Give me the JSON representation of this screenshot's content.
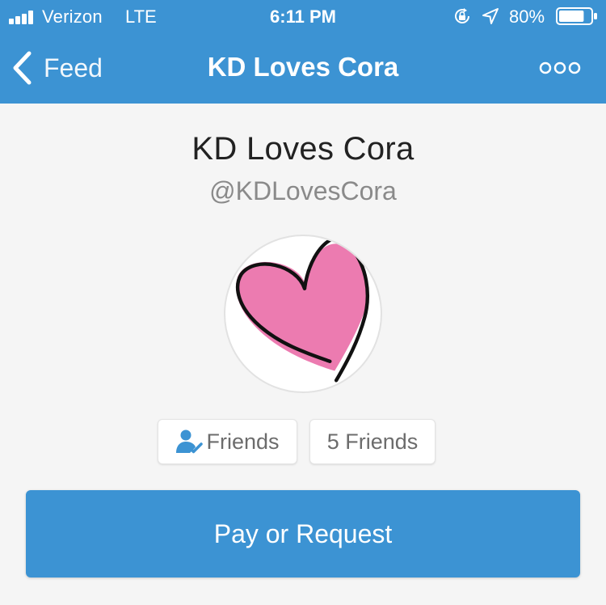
{
  "status_bar": {
    "carrier": "Verizon",
    "network": "LTE",
    "time": "6:11 PM",
    "battery_percent": "80%",
    "battery_level": 0.8,
    "icons": [
      "signal-icon",
      "orientation-lock-icon",
      "location-arrow-icon",
      "battery-icon"
    ]
  },
  "nav": {
    "back_label": "Feed",
    "title": "KD Loves Cora",
    "more_icon": "more-dots-icon"
  },
  "profile": {
    "name": "KD Loves Cora",
    "handle": "@KDLovesCora",
    "avatar_icon": "heart-icon"
  },
  "friends": {
    "status_label": "Friends",
    "status_icon": "friend-check-icon",
    "count_label": "5 Friends"
  },
  "actions": {
    "pay_request_label": "Pay or Request"
  },
  "colors": {
    "brand_blue": "#3c93d3",
    "background": "#f5f5f5",
    "heart_pink": "#ec7bb0"
  }
}
